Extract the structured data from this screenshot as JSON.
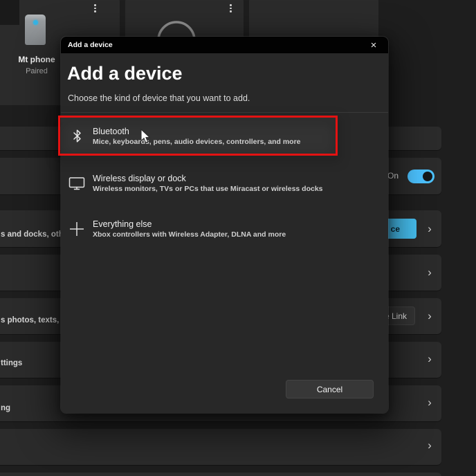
{
  "colors": {
    "accent_blue": "#4cc2ff",
    "highlight_red": "#e41212",
    "dialog_bg": "#282828",
    "titlebar_bg": "#020202",
    "card_bg": "#2b2b2b"
  },
  "background": {
    "tiles": {
      "phone": {
        "name": "Mt phone",
        "status": "Paired"
      }
    },
    "rows": {
      "bluetooth_toggle": {
        "state_label": "On"
      },
      "devices": {
        "left_fragment": "s and docks, other",
        "button_fragment": "ce",
        "chevron": "›"
      },
      "row_d": {
        "chevron": "›"
      },
      "phone_link": {
        "left_fragment": "s photos, texts, and",
        "button_fragment": "e Link",
        "chevron": "›"
      },
      "row_f": {
        "left_fragment": "ttings",
        "chevron": "›"
      },
      "row_g": {
        "left_fragment": "ng",
        "chevron": "›"
      },
      "row_h": {
        "chevron": "›"
      }
    }
  },
  "dialog": {
    "titlebar": {
      "title": "Add a device",
      "close_glyph": "×"
    },
    "heading": "Add a device",
    "subtitle": "Choose the kind of device that you want to add.",
    "options": [
      {
        "title": "Bluetooth",
        "description": "Mice, keyboards, pens, audio devices, controllers, and more"
      },
      {
        "title": "Wireless display or dock",
        "description": "Wireless monitors, TVs or PCs that use Miracast or wireless docks"
      },
      {
        "title": "Everything else",
        "description": "Xbox controllers with Wireless Adapter, DLNA and more"
      }
    ],
    "cancel_label": "Cancel"
  }
}
